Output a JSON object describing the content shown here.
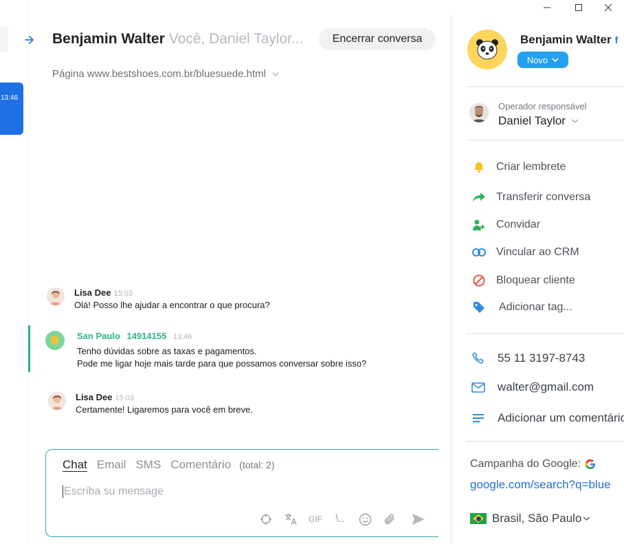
{
  "sidebar": {
    "active_time": "13:46"
  },
  "header": {
    "contact_name": "Benjamin Walter",
    "participants": "Você, Daniel Taylor...",
    "end_button": "Encerrar conversa",
    "page": "Página www.bestshoes.com.br/bluesuede.html"
  },
  "messages": [
    {
      "author": "Lisa Dee",
      "time": "15:03",
      "lines": [
        "Olá! Posso lhe ajudar a encontrar o que procura?"
      ]
    },
    {
      "author": "San Paulo",
      "id": "14914155",
      "time": "13:46",
      "lines": [
        "Tenho dúvidas sobre as taxas e pagamentos.",
        "Pode me ligar hoje mais tarde para que possamos conversar sobre isso?"
      ]
    },
    {
      "author": "Lisa Dee",
      "time": "15:03",
      "lines": [
        "Certamente! Ligaremos para você em breve."
      ]
    }
  ],
  "composer": {
    "tabs": [
      "Chat",
      "Email",
      "SMS",
      "Comentário"
    ],
    "total": "(total: 2)",
    "placeholder": "Escriba su mensage",
    "gif_label": "GIF",
    "shortcut_label": "\\.."
  },
  "contact": {
    "name": "Benjamin Walter",
    "social": "f",
    "status": "Novo",
    "operator_label": "Operador responsável",
    "operator_name": "Daniel Taylor"
  },
  "actions": [
    {
      "label": "Criar lembrete",
      "icon": "bell-icon",
      "color": "#f5c518"
    },
    {
      "label": "Transferir conversa",
      "icon": "share-arrow-icon",
      "color": "#2fb35a"
    },
    {
      "label": "Convidar",
      "icon": "add-user-icon",
      "color": "#2fb35a"
    },
    {
      "label": "Vincular ao CRM",
      "icon": "link-icon",
      "color": "#2f8ae1"
    },
    {
      "label": "Bloquear cliente",
      "icon": "block-icon",
      "color": "#e8533f"
    },
    {
      "label": "Adicionar tag...",
      "icon": "tag-icon",
      "color": "#2f8ae1"
    }
  ],
  "info": {
    "phone": "55 11 3197-8743",
    "email": "walter@gmail.com",
    "comment": "Adicionar um comentário"
  },
  "campaign": {
    "label": "Campanha do Google:",
    "link": "google.com/search?q=blue"
  },
  "location": "Brasil, São Paulo",
  "colors": {
    "accent": "#1f6fe5",
    "client": "#2fb282",
    "status": "#24a0f0"
  }
}
